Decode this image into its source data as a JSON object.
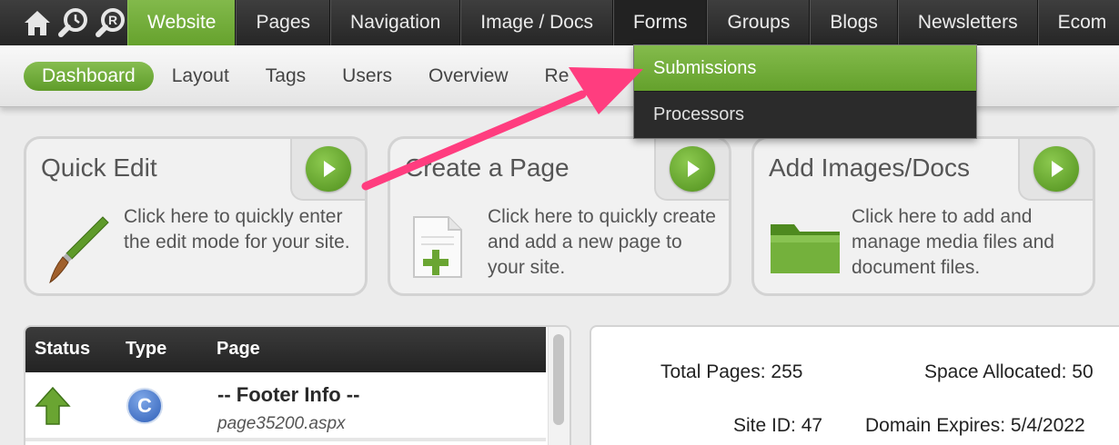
{
  "top_nav": {
    "icons": [
      "home-icon",
      "clock-search-icon",
      "registered-search-icon"
    ],
    "tabs": [
      {
        "label": "Website",
        "active": true
      },
      {
        "label": "Pages"
      },
      {
        "label": "Navigation"
      },
      {
        "label": "Image / Docs"
      },
      {
        "label": "Forms",
        "open": true
      },
      {
        "label": "Groups"
      },
      {
        "label": "Blogs"
      },
      {
        "label": "Newsletters"
      },
      {
        "label": "Ecom"
      }
    ]
  },
  "sub_nav": {
    "tabs": [
      {
        "label": "Dashboard",
        "active": true
      },
      {
        "label": "Layout"
      },
      {
        "label": "Tags"
      },
      {
        "label": "Users"
      },
      {
        "label": "Overview"
      },
      {
        "label": "Re"
      }
    ]
  },
  "forms_dropdown": {
    "items": [
      {
        "label": "Submissions",
        "active": true
      },
      {
        "label": "Processors"
      }
    ]
  },
  "cards": [
    {
      "title": "Quick Edit",
      "icon": "paintbrush-icon",
      "description": "Click here to quickly enter the edit mode for your site."
    },
    {
      "title": "Create a Page",
      "icon": "new-page-icon",
      "description": "Click here to quickly create and add a new page to your site."
    },
    {
      "title": "Add Images/Docs",
      "icon": "folder-icon",
      "description": "Click here to add and manage media files and document files."
    }
  ],
  "pages_table": {
    "columns": [
      "Status",
      "Type",
      "Page"
    ],
    "rows": [
      {
        "status_icon": "green-up-arrow-icon",
        "type": "C",
        "page_name": "-- Footer Info --",
        "page_file": "page35200.aspx"
      }
    ]
  },
  "site_stats": {
    "total_pages": "Total Pages: 255",
    "space_allocated": "Space Allocated: 50",
    "site_id": "Site ID: 47",
    "domain_expires": "Domain Expires: 5/4/2022"
  },
  "colors": {
    "accent_green": "#6aa532",
    "nav_dark": "#2b2b2b",
    "callout_arrow": "#ff3d7f"
  }
}
